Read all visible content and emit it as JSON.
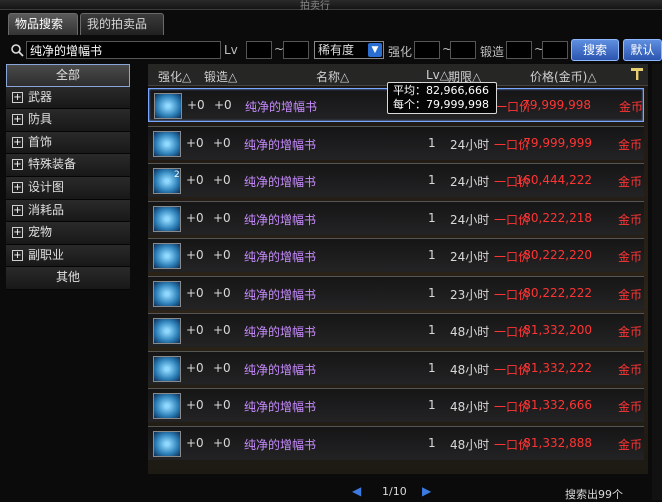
{
  "window": {
    "title": "拍卖行"
  },
  "tabs": [
    {
      "label": "物品搜索"
    },
    {
      "label": "我的拍卖品"
    }
  ],
  "filter": {
    "search_value": "纯净的增幅书",
    "lv_label": "Lv",
    "tilde": "~",
    "rarity_selected": "稀有度",
    "strengthen_label": "强化",
    "forge_label": "锻造",
    "search_button": "搜索",
    "default_button": "默认"
  },
  "sidebar": {
    "items": [
      {
        "label": "全部"
      },
      {
        "label": "武器"
      },
      {
        "label": "防具"
      },
      {
        "label": "首饰"
      },
      {
        "label": "特殊装备"
      },
      {
        "label": "设计图"
      },
      {
        "label": "消耗品"
      },
      {
        "label": "宠物"
      },
      {
        "label": "副职业"
      },
      {
        "label": "其他"
      }
    ],
    "plus_glyph": "+"
  },
  "table": {
    "columns": [
      "强化△",
      "锻造△",
      "名称△",
      "Lv△",
      "期限△",
      "价格(金币)△"
    ],
    "rows": [
      {
        "strengthen": "+0",
        "forge": "+0",
        "name": "纯净的增幅书",
        "lv": "",
        "period": "",
        "type": "一口价",
        "price": "79,999,998",
        "currency": "金币",
        "stack": ""
      },
      {
        "strengthen": "+0",
        "forge": "+0",
        "name": "纯净的增幅书",
        "lv": "1",
        "period": "24小时",
        "type": "一口价",
        "price": "79,999,999",
        "currency": "金币",
        "stack": ""
      },
      {
        "strengthen": "+0",
        "forge": "+0",
        "name": "纯净的增幅书",
        "lv": "1",
        "period": "24小时",
        "type": "一口价",
        "price": "160,444,222",
        "currency": "金币",
        "stack": "2"
      },
      {
        "strengthen": "+0",
        "forge": "+0",
        "name": "纯净的增幅书",
        "lv": "1",
        "period": "24小时",
        "type": "一口价",
        "price": "80,222,218",
        "currency": "金币",
        "stack": ""
      },
      {
        "strengthen": "+0",
        "forge": "+0",
        "name": "纯净的增幅书",
        "lv": "1",
        "period": "24小时",
        "type": "一口价",
        "price": "80,222,220",
        "currency": "金币",
        "stack": ""
      },
      {
        "strengthen": "+0",
        "forge": "+0",
        "name": "纯净的增幅书",
        "lv": "1",
        "period": "23小时",
        "type": "一口价",
        "price": "80,222,222",
        "currency": "金币",
        "stack": ""
      },
      {
        "strengthen": "+0",
        "forge": "+0",
        "name": "纯净的增幅书",
        "lv": "1",
        "period": "48小时",
        "type": "一口价",
        "price": "81,332,200",
        "currency": "金币",
        "stack": ""
      },
      {
        "strengthen": "+0",
        "forge": "+0",
        "name": "纯净的增幅书",
        "lv": "1",
        "period": "48小时",
        "type": "一口价",
        "price": "81,332,222",
        "currency": "金币",
        "stack": ""
      },
      {
        "strengthen": "+0",
        "forge": "+0",
        "name": "纯净的增幅书",
        "lv": "1",
        "period": "48小时",
        "type": "一口价",
        "price": "81,332,666",
        "currency": "金币",
        "stack": ""
      },
      {
        "strengthen": "+0",
        "forge": "+0",
        "name": "纯净的增幅书",
        "lv": "1",
        "period": "48小时",
        "type": "一口价",
        "price": "81,332,888",
        "currency": "金币",
        "stack": ""
      }
    ]
  },
  "tooltip": {
    "avg": "平均：82,966,666",
    "each": "每个：79,999,998"
  },
  "pager": {
    "text": "1/10",
    "prev": "◀",
    "next": "▶"
  },
  "result_count": "搜索出99个",
  "colors": {
    "accent": "#2b55b0",
    "price": "#ff3434",
    "item_name": "#c88cff"
  }
}
